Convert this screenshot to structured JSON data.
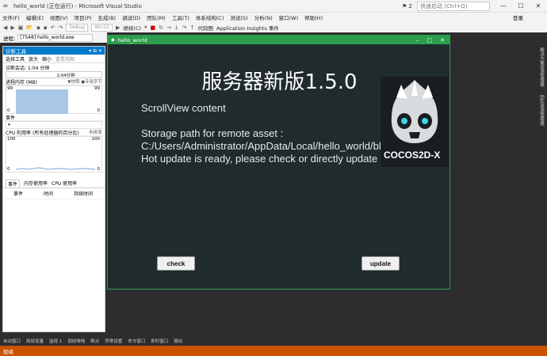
{
  "window": {
    "title": "hello_world (正在运行) - Microsoft Visual Studio",
    "notifications": "2",
    "search_placeholder": "快速启动 (Ctrl+Q)"
  },
  "menu": {
    "items": [
      "文件(F)",
      "编辑(E)",
      "视图(V)",
      "项目(P)",
      "生成(B)",
      "调试(D)",
      "团队(M)",
      "工具(T)",
      "体系结构(C)",
      "测试(S)",
      "分析(N)",
      "窗口(W)",
      "帮助(H)"
    ],
    "login": "登录"
  },
  "toolbar": {
    "config": "Debug",
    "platform": "Win32",
    "continue": "继续(C)",
    "code_map": "代码图",
    "insights": "Application Insights 事件"
  },
  "process": {
    "label": "进程:",
    "value": "[7548] hello_world.exe"
  },
  "diagnostics": {
    "title": "诊断工具",
    "tools_btn": "选择工具",
    "zoom_in": "放大",
    "zoom_out": "缩小",
    "reset_view": "重置视图",
    "session": "诊断会话: 1:04 分钟",
    "time_marker": "1:04分钟",
    "memory_label": "进程内存 (MB)",
    "memory_legend": "▼快照  ●专用字节",
    "memory_max_left": "99",
    "memory_max_right": "99",
    "memory_min_left": "0",
    "memory_min_right": "0",
    "memory_level": 0.6,
    "events_label": "事件",
    "cpu_label": "CPU 利用率 (所有处理器的百分比)",
    "cpu_right": "利用率",
    "cpu_max_left": "100",
    "cpu_max_right": "100",
    "cpu_min_left": "0",
    "cpu_min_right": "0",
    "tabs": [
      "事件",
      "内存使用率",
      "CPU 使用率"
    ],
    "columns": [
      "事件",
      "时间",
      "持续时间"
    ]
  },
  "app": {
    "window_title": "hello_world",
    "heading": "服务器新版1.5.0",
    "scroll_text": "ScrollView content",
    "storage_label": "Storage path for remote asset :",
    "storage_path": "C:/Users/Administrator/AppData/Local/hello_world/blackjac",
    "status_text": "Hot update is ready, please check or directly update",
    "check_button": "check",
    "update_button": "update",
    "logo_text": "COCOS2D-X"
  },
  "right_rail": [
    "解决方案资源管理器",
    "团队资源管理器"
  ],
  "bottom_tabs": [
    "自动窗口",
    "局部变量",
    "监视 1",
    "调用堆栈",
    "断点",
    "异常设置",
    "命令窗口",
    "即时窗口",
    "输出"
  ],
  "status": "就绪"
}
